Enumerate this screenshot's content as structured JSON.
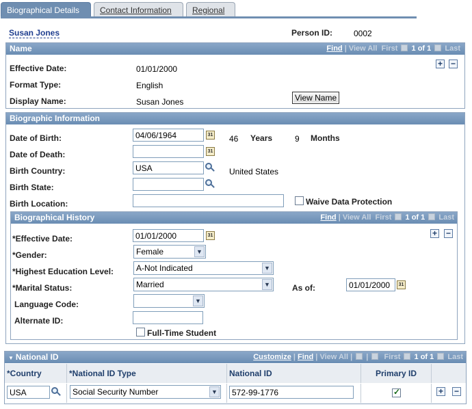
{
  "tabs": [
    {
      "label": "Biographical Details"
    },
    {
      "label": "Contact Information"
    },
    {
      "label": "Regional"
    }
  ],
  "person": {
    "name": "Susan Jones",
    "id_label": "Person ID:",
    "id_value": "0002"
  },
  "nav": {
    "find": "Find",
    "view_all": "View All",
    "first": "First",
    "count": "1 of 1",
    "last": "Last",
    "customize": "Customize",
    "separator": "|"
  },
  "name_section": {
    "title": "Name",
    "effective_date_label": "Effective Date:",
    "effective_date": "01/01/2000",
    "format_type_label": "Format Type:",
    "format_type": "English",
    "display_name_label": "Display Name:",
    "display_name": "Susan Jones",
    "view_name_button": "View Name"
  },
  "bio_info": {
    "title": "Biographic Information",
    "dob_label": "Date of Birth:",
    "dob": "04/06/1964",
    "age_years": "46",
    "years_label": "Years",
    "age_months": "9",
    "months_label": "Months",
    "dod_label": "Date of Death:",
    "dod": "",
    "birth_country_label": "Birth Country:",
    "birth_country": "USA",
    "birth_country_desc": "United States",
    "birth_state_label": "Birth State:",
    "birth_state": "",
    "birth_location_label": "Birth Location:",
    "birth_location": "",
    "waive_label": "Waive Data Protection",
    "waive_checked": false
  },
  "bio_history": {
    "title": "Biographical History",
    "effective_date_label": "*Effective Date:",
    "effective_date": "01/01/2000",
    "gender_label": "*Gender:",
    "gender": "Female",
    "education_label": "*Highest Education Level:",
    "education": "A-Not Indicated",
    "marital_label": "*Marital Status:",
    "marital": "Married",
    "as_of_label": "As of:",
    "as_of": "01/01/2000",
    "language_label": "Language Code:",
    "language": "",
    "alternate_id_label": "Alternate ID:",
    "alternate_id": "",
    "fulltime_label": "Full-Time Student",
    "fulltime_checked": false
  },
  "national_id": {
    "title": "National ID",
    "columns": [
      "*Country",
      "*National ID Type",
      "National ID",
      "Primary ID"
    ],
    "rows": [
      {
        "country": "USA",
        "id_type": "Social Security Number",
        "id": "572-99-1776",
        "primary": true
      }
    ]
  },
  "icons": {
    "calendar": "calendar-icon",
    "lookup": "magnifier-icon",
    "add": "+",
    "delete": "−",
    "calendar_text": "31"
  }
}
